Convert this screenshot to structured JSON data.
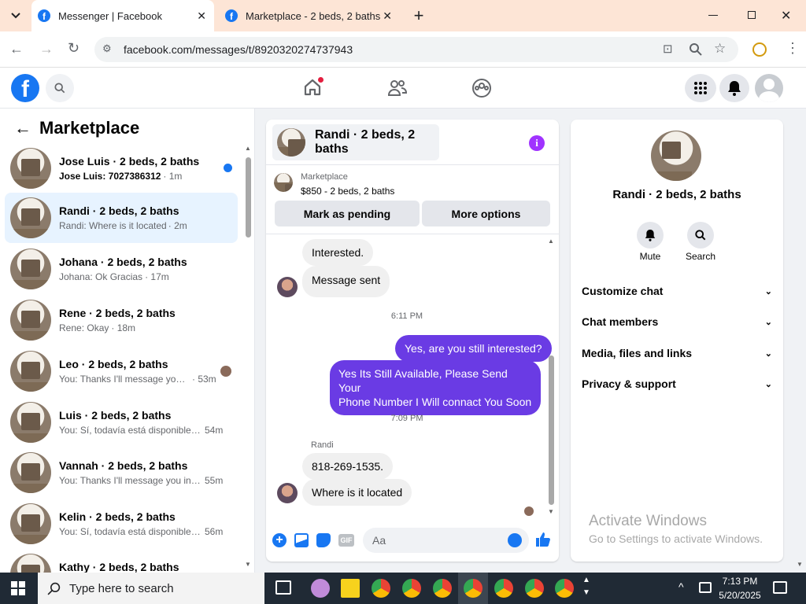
{
  "browser": {
    "tabs": [
      {
        "title": "Messenger | Facebook"
      },
      {
        "title": "Marketplace - 2 beds, 2 baths |"
      }
    ],
    "url": "facebook.com/messages/t/8920320274737943"
  },
  "sidebar": {
    "title": "Marketplace",
    "conversations": [
      {
        "name": "Jose Luis · 2 beds, 2 baths",
        "preview": "Jose Luis: 7027386312",
        "time": "· 1m"
      },
      {
        "name": "Randi · 2 beds, 2 baths",
        "preview": "Randi: Where is it located",
        "time": "· 2m"
      },
      {
        "name": "Johana · 2 beds, 2 baths",
        "preview": "Johana: Ok Gracias",
        "time": "· 17m"
      },
      {
        "name": "Rene · 2 beds, 2 baths",
        "preview": "Rene: Okay",
        "time": "· 18m"
      },
      {
        "name": "Leo · 2 beds, 2 baths",
        "preview": "You: Thanks I'll message you i...",
        "time": "· 53m"
      },
      {
        "name": "Luis · 2 beds, 2 baths",
        "preview": "You: Sí, todavía está disponible, e...",
        "time": "54m"
      },
      {
        "name": "Vannah · 2 beds, 2 baths",
        "preview": "You: Thanks I'll message you in a ...",
        "time": "55m"
      },
      {
        "name": "Kelin · 2 beds, 2 baths",
        "preview": "You: Sí, todavía está disponible, e...",
        "time": "56m"
      },
      {
        "name": "Kathy · 2 beds, 2 baths",
        "preview": "",
        "time": ""
      }
    ]
  },
  "chat": {
    "title": "Randi · 2 beds, 2 baths",
    "listing": {
      "source": "Marketplace",
      "price": "$850 - 2 beds, 2 baths"
    },
    "actions": {
      "pending": "Mark as pending",
      "more": "More options"
    },
    "messages": {
      "m1": "Interested.",
      "m2": "Message sent",
      "t1": "6:11 PM",
      "m3": "Yes, are you still interested?",
      "m4a": "Yes Its Still Available, Please Send Your",
      "m4b": "Phone Number I Will connact You Soon",
      "t2": "7:09 PM",
      "sender": "Randi",
      "m5": "818-269-1535.",
      "m6": "Where is it located"
    },
    "composer": {
      "placeholder": "Aa"
    }
  },
  "details": {
    "name": "Randi · 2 beds, 2 baths",
    "mute": "Mute",
    "search": "Search",
    "sections": [
      "Customize chat",
      "Chat members",
      "Media, files and links",
      "Privacy & support"
    ]
  },
  "watermark": {
    "line1": "Activate Windows",
    "line2": "Go to Settings to activate Windows."
  },
  "taskbar": {
    "search_placeholder": "Type here to search",
    "time": "7:13 PM",
    "date": "5/20/2025"
  },
  "colors": {
    "accent": "#6a3be4",
    "fb_blue": "#1877f2",
    "selected": "#e7f3ff"
  }
}
